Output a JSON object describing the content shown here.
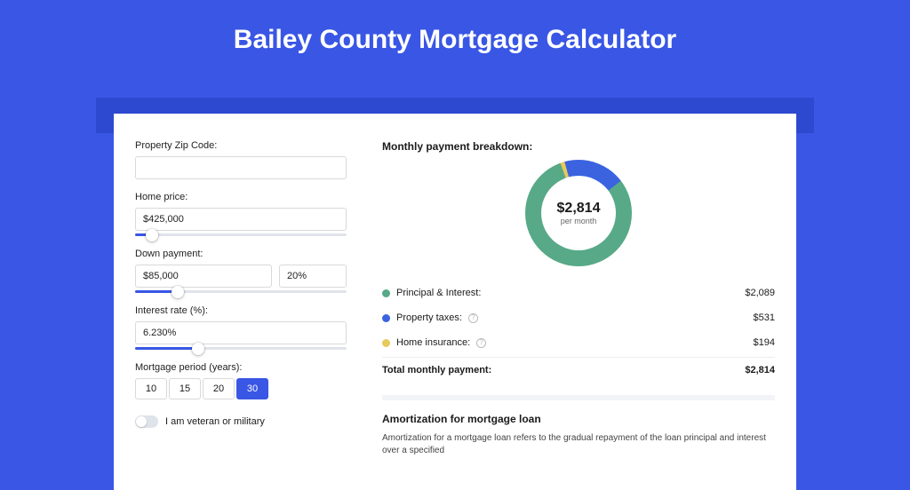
{
  "title": "Bailey County Mortgage Calculator",
  "colors": {
    "green": "#57a987",
    "blue": "#3b63e0",
    "yellow": "#e8c95c"
  },
  "form": {
    "zip": {
      "label": "Property Zip Code:",
      "value": ""
    },
    "price": {
      "label": "Home price:",
      "value": "$425,000",
      "slider_pct": 8
    },
    "down": {
      "label": "Down payment:",
      "amount": "$85,000",
      "pct": "20%",
      "slider_pct": 20
    },
    "rate": {
      "label": "Interest rate (%):",
      "value": "6.230%",
      "slider_pct": 30
    },
    "period": {
      "label": "Mortgage period (years):",
      "options": [
        "10",
        "15",
        "20",
        "30"
      ],
      "selected": "30"
    },
    "veteran": {
      "label": "I am veteran or military",
      "on": false
    }
  },
  "breakdown": {
    "title": "Monthly payment breakdown:",
    "center_amount": "$2,814",
    "center_sub": "per month",
    "items": [
      {
        "swatch": "green",
        "label": "Principal & Interest:",
        "value": "$2,089",
        "help": false
      },
      {
        "swatch": "blue",
        "label": "Property taxes:",
        "value": "$531",
        "help": true
      },
      {
        "swatch": "yellow",
        "label": "Home insurance:",
        "value": "$194",
        "help": true
      }
    ],
    "total_label": "Total monthly payment:",
    "total_value": "$2,814"
  },
  "amort": {
    "title": "Amortization for mortgage loan",
    "body": "Amortization for a mortgage loan refers to the gradual repayment of the loan principal and interest over a specified"
  },
  "chart_data": {
    "type": "pie",
    "title": "Monthly payment breakdown",
    "series": [
      {
        "name": "Principal & Interest",
        "value": 2089,
        "color": "#57a987"
      },
      {
        "name": "Property taxes",
        "value": 531,
        "color": "#3b63e0"
      },
      {
        "name": "Home insurance",
        "value": 194,
        "color": "#e8c95c"
      }
    ],
    "total": 2814,
    "center_label": "$2,814 per month"
  }
}
